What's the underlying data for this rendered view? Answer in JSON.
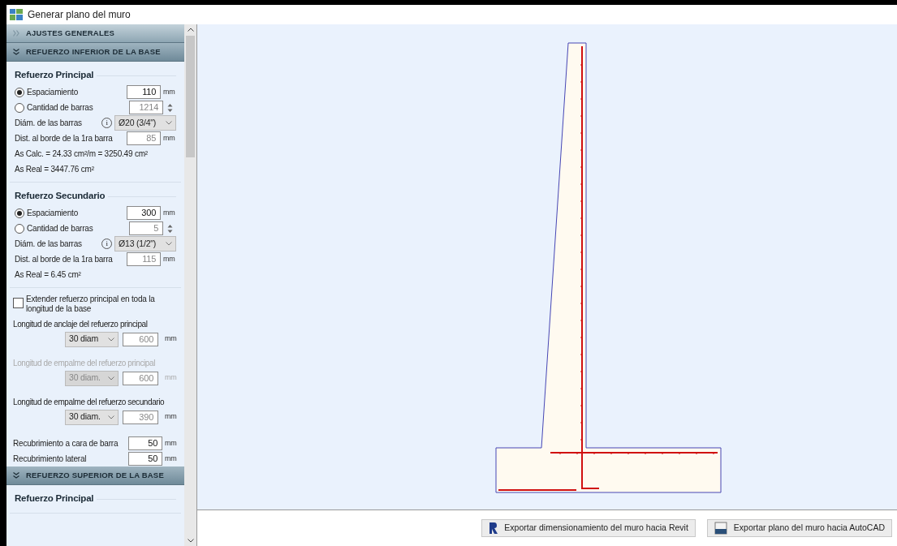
{
  "window": {
    "title": "Generar plano del muro"
  },
  "sidebar": {
    "sections": [
      {
        "title": "AJUSTES GENERALES",
        "expanded": false
      },
      {
        "title": "REFUERZO INFERIOR DE LA BASE",
        "expanded": true,
        "groups": [
          {
            "title": "Refuerzo Principal",
            "rows": [
              {
                "kind": "radio",
                "label": "Espaciamiento",
                "selected": true,
                "value": "110",
                "unit": "mm"
              },
              {
                "kind": "radio",
                "label": "Cantidad de barras",
                "selected": false,
                "value": "1214",
                "spinner": true
              },
              {
                "kind": "dropdown",
                "label": "Diám. de las barras",
                "value": "Ø20 (3/4\")",
                "info": "i"
              },
              {
                "kind": "field",
                "label": "Dist. al borde de la 1ra barra",
                "value": "85",
                "unit": "mm",
                "readonly": true
              },
              {
                "kind": "note",
                "text": "As Calc. = 24.33 cm²/m = 3250.49 cm²"
              },
              {
                "kind": "note",
                "text": "As Real = 3447.76 cm²"
              }
            ]
          },
          {
            "title": "Refuerzo Secundario",
            "rows": [
              {
                "kind": "radio",
                "label": "Espaciamiento",
                "selected": true,
                "value": "300",
                "unit": "mm"
              },
              {
                "kind": "radio",
                "label": "Cantidad de barras",
                "selected": false,
                "value": "5",
                "spinner": true
              },
              {
                "kind": "dropdown",
                "label": "Diám. de las barras",
                "value": "Ø13 (1/2\")",
                "info": "i"
              },
              {
                "kind": "field",
                "label": "Dist. al borde de la 1ra barra",
                "value": "115",
                "unit": "mm",
                "readonly": true
              },
              {
                "kind": "note",
                "text": "As Real = 6.45 cm²"
              }
            ]
          }
        ],
        "items": [
          {
            "kind": "checkbox",
            "label": "Extender refuerzo principal en toda la longitud de la base",
            "checked": false
          },
          {
            "kind": "length",
            "label": "Longitud de anclaje del refuerzo principal",
            "dropdown": "30 diam",
            "value": "600",
            "unit": "mm",
            "disabled": false
          },
          {
            "kind": "length",
            "label": "Longitud de empalme del refuerzo principal",
            "dropdown": "30 diam.",
            "value": "600",
            "unit": "mm",
            "disabled": true
          },
          {
            "kind": "length",
            "label": "Longitud de empalme del refuerzo secundario",
            "dropdown": "30 diam.",
            "value": "390",
            "unit": "mm",
            "disabled": false
          },
          {
            "kind": "field",
            "label": "Recubrimiento a cara de barra",
            "value": "50",
            "unit": "mm"
          },
          {
            "kind": "field",
            "label": "Recubrimiento lateral",
            "value": "50",
            "unit": "mm"
          }
        ]
      },
      {
        "title": "REFUERZO SUPERIOR DE LA BASE",
        "expanded": true,
        "groups": [
          {
            "title": "Refuerzo Principal"
          }
        ]
      }
    ]
  },
  "buttons": [
    {
      "kind": "revit",
      "label": "Exportar dimensionamiento del muro hacia Revit"
    },
    {
      "kind": "autocad",
      "label": "Exportar plano del muro hacia AutoCAD"
    }
  ]
}
